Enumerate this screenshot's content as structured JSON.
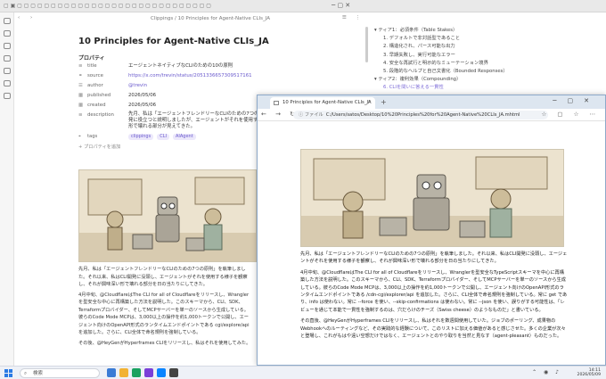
{
  "obsidian": {
    "breadcrumb": "Clippings / 10 Principles for Agent-Native CLIs_JA",
    "title": "10 Principles for Agent-Native CLIs_JA",
    "properties_label": "プロパティ",
    "properties": [
      {
        "key": "title",
        "value": "エージェントネイティブなCLIのための10の原則"
      },
      {
        "key": "source",
        "value": "https://x.com/trevin/status/2051336657309517161"
      },
      {
        "key": "author",
        "value": "@trevin"
      },
      {
        "key": "published",
        "value": "2026/05/06"
      },
      {
        "key": "created",
        "value": "2026/05/06"
      },
      {
        "key": "description",
        "value": "先月、私は「エージェントフレンドリーなCLIのための7つの原則」を執筆しました。CLIの開発に役立つと説明しましたが、エージェントがそれを使用する様子を観察し、それが興味深い形で壊れる部分が見えてきた。"
      }
    ],
    "tags_key": "tags",
    "tags": [
      "clippings",
      "CLI",
      "AIAgent"
    ],
    "add_property": "プロパティを追加",
    "para1": "先月、私は「エージェントフレンドリーなCLIのための7つの原則」を執筆しました。それ以来、私はCLI開発に没頭し、エージェントがそれを使用する様子を観察し、それが興味深い形で壊れる部分を日の当たりにしてきた。",
    "para2": "4月中旬、@CloudflareはThe CLI for all of Cloudflareをリリースし、Wranglerを型安全な中心に再構築した方法を説明した。このスキーマから、CLI、SDK、Terraformプロバイダー、そしてMCPサーバーを単一のソースから生成している。彼らのCode Mode MCPは、3,000以上の操作を約1,000トークンで公開し、エージェント向けのOpenAPI形式のランタイムエンドポイントである cgi/explore/api を追加した。さらに、CLI全体で命名規則を強制している。",
    "para3": "その後、@HeyGenがHyperframes CLIをリリースし、私はそれを使用してみた。"
  },
  "outline": [
    {
      "text": "ティア1：必須条件（Table Stakes）",
      "level": 1
    },
    {
      "text": "1. デフォルトで非対話型であること",
      "level": 2
    },
    {
      "text": "2. 構造化され、パース可能な出力",
      "level": 2
    },
    {
      "text": "3. 早期失敗し、実行可能なエラー",
      "level": 2
    },
    {
      "text": "4. 安全な再試行と明示的なミューテーション境界",
      "level": 2
    },
    {
      "text": "5. 段階的なヘルプと自己文書化（Bounded Responses）",
      "level": 2
    },
    {
      "text": "ティア2：複利効果（Compounding）",
      "level": 1
    },
    {
      "text": "6. CLIを問いに答える一貫性",
      "level": 2
    }
  ],
  "browser": {
    "tab_title": "10 Principles for Agent-Native CLIs_JA",
    "url_label": "ファイル",
    "url": "C:/Users/satos/Desktop/10%20Principles%20for%20Agent-Native%20CLIs_JA.mhtml",
    "para1": "先月、私は「エージェントフレンドリーなCLIのための7つの原則」を執筆しました。それ以来、私はCLI開発に没頭し、エージェントがそれを使用する様子を観察し、それが興味深い形で壊れる部分を日の当たりにしてきた。",
    "para2": "4月中旬、@CloudflareはThe CLI for all of Cloudflareをリリースし、Wranglerを型安全なTypeScriptスキーマを中心に再構築した方法を説明した。このスキーマから、CLI、SDK、Terraformプロバイダー、そしてMCPサーバーを単一のソースから生成している。彼らのCode Mode MCPは、3,000以上の操作を約1,000トークンで公開し、エージェント向けのOpenAPI形式のランタイムエンドポイントである /cdn-cgi/explorer/api を追加した。さらに、CLI全体で命名規則を強制している。常に get であり、info は使わない。常に --force を使い、--skip-confirmations は使わない。常に --json を使い、誤りがする可能性は、「レビューを通じて本能で一貫性を強制するのは、穴だらけのチーズ（Swiss cheese）のようなものだ」と書いている。",
    "para3": "その直後、@HeyGenがHyperframes CLIをリリースし、私はそれを数週間使用していた。ジョブのポーリング、成果物のWebhookへのルーティングなど、その実践的な経験について、このリストに加える価値があると感じさせた。多くの企業が次々と登場し、これがもはや遠い空想だけではなく、エージェントとのやり取りを当然と見なす（agent-pleasant）ものだった。"
  },
  "taskbar": {
    "search_placeholder": "検索",
    "time": "14:11",
    "date": "2026/05/09"
  }
}
